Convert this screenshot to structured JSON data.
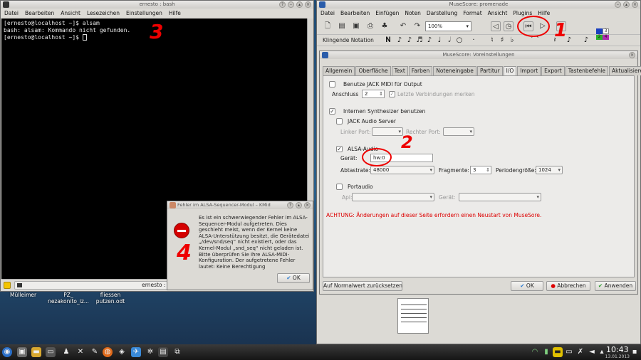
{
  "desktop": {
    "icons": [
      "Mülleimer",
      "PZ_\nnezakonito_iz...",
      "fliessen\nputzen.odt"
    ]
  },
  "terminal": {
    "title": "ernesto : bash",
    "menu": [
      "Datei",
      "Bearbeiten",
      "Ansicht",
      "Lesezeichen",
      "Einstellungen",
      "Hilfe"
    ],
    "lines": [
      "[ernesto@localhost ~]$ alsam",
      "bash: alsam: Kommando nicht gefunden.",
      "[ernesto@localhost ~]$ "
    ],
    "tab_label": "ernesto : bash"
  },
  "musescore": {
    "title": "MuseScore: promenade",
    "menu": [
      "Datei",
      "Bearbeiten",
      "Einfügen",
      "Noten",
      "Darstellung",
      "Format",
      "Ansicht",
      "Plugins",
      "Hilfe"
    ],
    "zoom": "100%",
    "toolbar2_label": "Klingende Notation"
  },
  "prefs": {
    "title": "MuseScore: Voreinstellungen",
    "tabs": [
      "Allgemein",
      "Oberfläche",
      "Text",
      "Farben",
      "Noteneingabe",
      "Partitur",
      "I/O",
      "Import",
      "Export",
      "Tastenbefehle",
      "Aktualisieren"
    ],
    "jack_midi_label": "Benutze JACK MIDI für Output",
    "anschluss_label": "Anschluss",
    "anschluss_value": "2",
    "letzte_label": "Letzte Verbindungen merken",
    "intern_synth_label": "Internen Synthesizer benutzen",
    "jack_audio_label": "JACK Audio Server",
    "linker_port_label": "Linker Port:",
    "rechter_port_label": "Rechter Port:",
    "alsa_label": "ALSA-Audio",
    "geraet_label": "Gerät:",
    "geraet_value": "hw:0",
    "abtastrate_label": "Abtastrate:",
    "abtastrate_value": "48000",
    "fragmente_label": "Fragmente:",
    "fragmente_value": "3",
    "periodengroesse_label": "Periodengröße:",
    "periodengroesse_value": "1024",
    "portaudio_label": "Portaudio",
    "api_label": "Api:",
    "geraet2_label": "Gerät:",
    "warning": "ACHTUNG: Änderungen auf dieser Seite erfordern einen Neustart von MuseSore.",
    "reset_button": "Auf Normalwert zurücksetzen",
    "ok_button": "OK",
    "cancel_button": "Abbrechen",
    "apply_button": "Anwenden"
  },
  "error_dialog": {
    "title": "Fehler im ALSA-Sequencer-Modul – KMid",
    "message": "Es ist ein schwerwiegender Fehler im ALSA-Sequencer-Modul aufgetreten. Dies geschieht meist, wenn der Kernel keine ALSA-Unterstützung besitzt, die Gerätedatei „/dev/snd/seq“ nicht existiert, oder das Kernel-Modul „snd_seq“ nicht geladen ist. Bitte überprüfen Sie Ihre ALSA-MIDI-Konfiguration. Der aufgetretene Fehler lautet: Keine Berechtigung",
    "ok_button": "OK"
  },
  "annotations": [
    "1",
    "2",
    "3",
    "4"
  ],
  "taskbar": {
    "time": "10:43",
    "date": "13.01.2013"
  },
  "colors": {
    "annotation": "#e00000",
    "warning": "#dd0000"
  }
}
